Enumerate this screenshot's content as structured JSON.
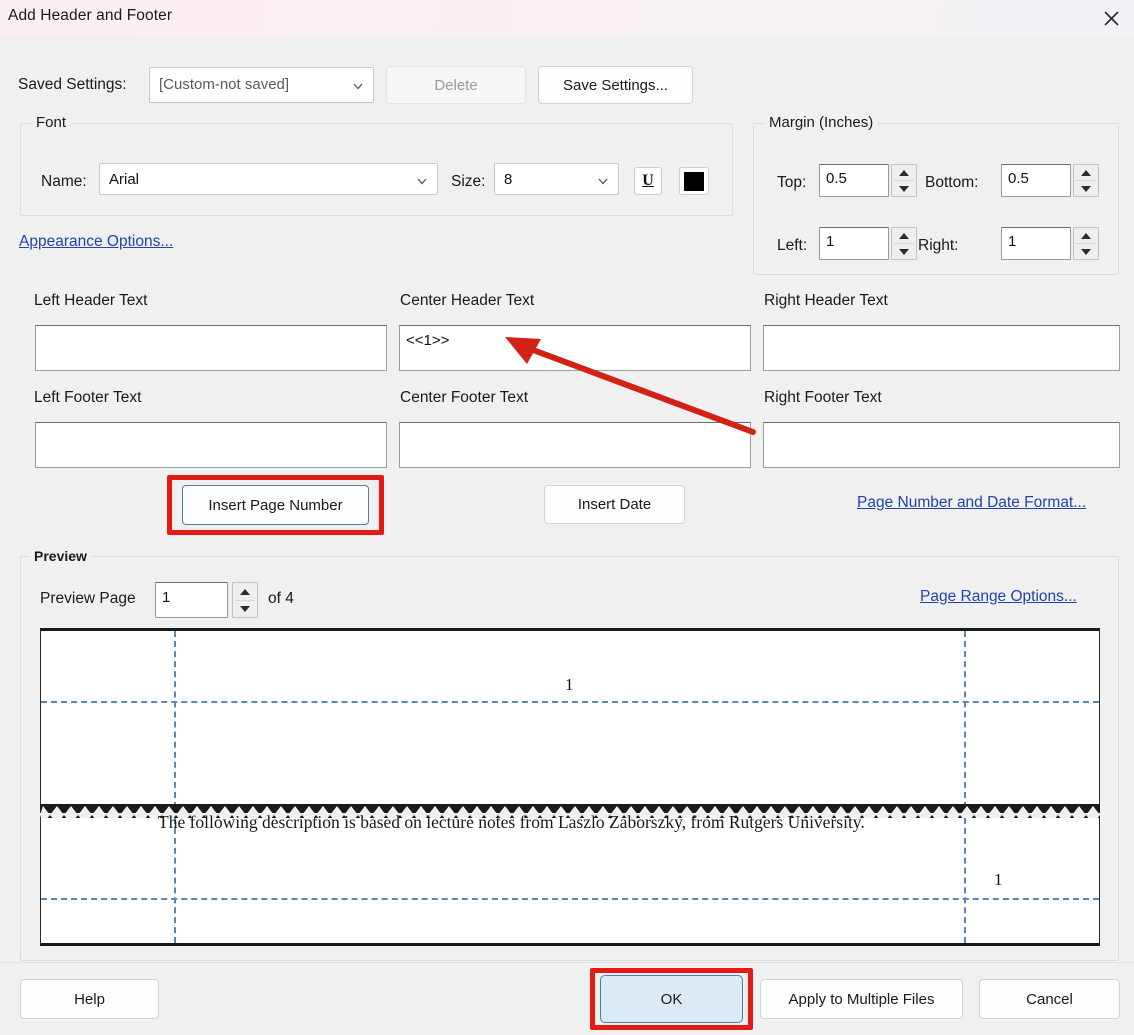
{
  "window": {
    "title": "Add Header and Footer",
    "close_icon": "close-icon"
  },
  "saved_settings": {
    "label": "Saved Settings:",
    "value": "[Custom-not saved]",
    "delete_label": "Delete",
    "save_label": "Save Settings..."
  },
  "font": {
    "legend": "Font",
    "name_label": "Name:",
    "name_value": "Arial",
    "size_label": "Size:",
    "size_value": "8",
    "underline_glyph": "U",
    "color_hex": "#000000",
    "appearance_link": "Appearance Options..."
  },
  "margin": {
    "legend": "Margin (Inches)",
    "top_label": "Top:",
    "top_value": "0.5",
    "bottom_label": "Bottom:",
    "bottom_value": "0.5",
    "left_label": "Left:",
    "left_value": "1",
    "right_label": "Right:",
    "right_value": "1"
  },
  "headers": {
    "left_header_label": "Left Header Text",
    "left_header_value": "",
    "center_header_label": "Center Header Text",
    "center_header_value": "<<1>>",
    "right_header_label": "Right Header Text",
    "right_header_value": "",
    "left_footer_label": "Left Footer Text",
    "left_footer_value": "",
    "center_footer_label": "Center Footer Text",
    "center_footer_value": "",
    "right_footer_label": "Right Footer Text",
    "right_footer_value": ""
  },
  "inserts": {
    "insert_page_number": "Insert Page Number",
    "insert_date": "Insert Date",
    "format_link": "Page Number and Date Format..."
  },
  "preview": {
    "legend": "Preview",
    "page_label": "Preview Page",
    "page_value": "1",
    "of_label": "of 4",
    "range_link": "Page Range Options...",
    "top_page_number": "1",
    "bottom_page_number": "1",
    "document_text": "The following description is based on lecture notes from Laszlo Zaborszky, from Rutgers University."
  },
  "footer_buttons": {
    "help": "Help",
    "ok": "OK",
    "apply": "Apply to Multiple Files",
    "cancel": "Cancel"
  },
  "annotations": {
    "highlight_color": "#e41b13",
    "arrow_color": "#d32118"
  }
}
